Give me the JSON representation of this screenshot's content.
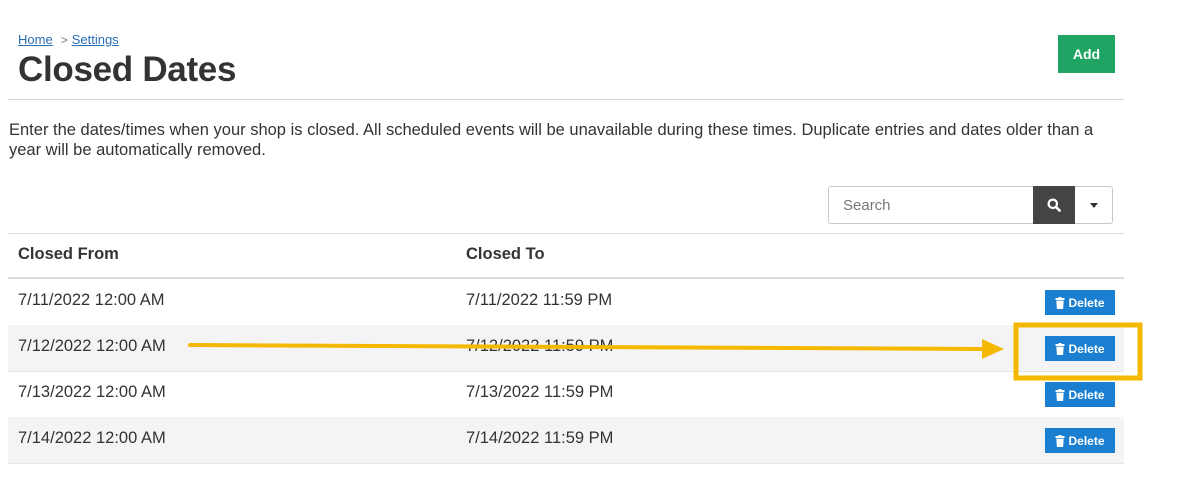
{
  "breadcrumb": {
    "home": "Home",
    "separator": ">",
    "settings": "Settings"
  },
  "page": {
    "title": "Closed Dates",
    "add_label": "Add",
    "description": "Enter the dates/times when your shop is closed. All scheduled events will be unavailable during these times. Duplicate entries and dates older than a year will be automatically removed."
  },
  "search": {
    "placeholder": "Search"
  },
  "icons": {
    "search": "search-icon",
    "dropdown": "caret-down-icon",
    "delete": "trash-icon"
  },
  "table": {
    "headers": {
      "from": "Closed From",
      "to": "Closed To"
    },
    "rows": [
      {
        "from": "7/11/2022 12:00 AM",
        "to": "7/11/2022 11:59 PM",
        "action": "Delete"
      },
      {
        "from": "7/12/2022 12:00 AM",
        "to": "7/12/2022 11:59 PM",
        "action": "Delete"
      },
      {
        "from": "7/13/2022 12:00 AM",
        "to": "7/13/2022 11:59 PM",
        "action": "Delete"
      },
      {
        "from": "7/14/2022 12:00 AM",
        "to": "7/14/2022 11:59 PM",
        "action": "Delete"
      }
    ]
  },
  "colors": {
    "add_button": "#1fa463",
    "delete_button": "#1a7fd0",
    "link": "#2a6db5",
    "annotation": "#f5b800"
  }
}
